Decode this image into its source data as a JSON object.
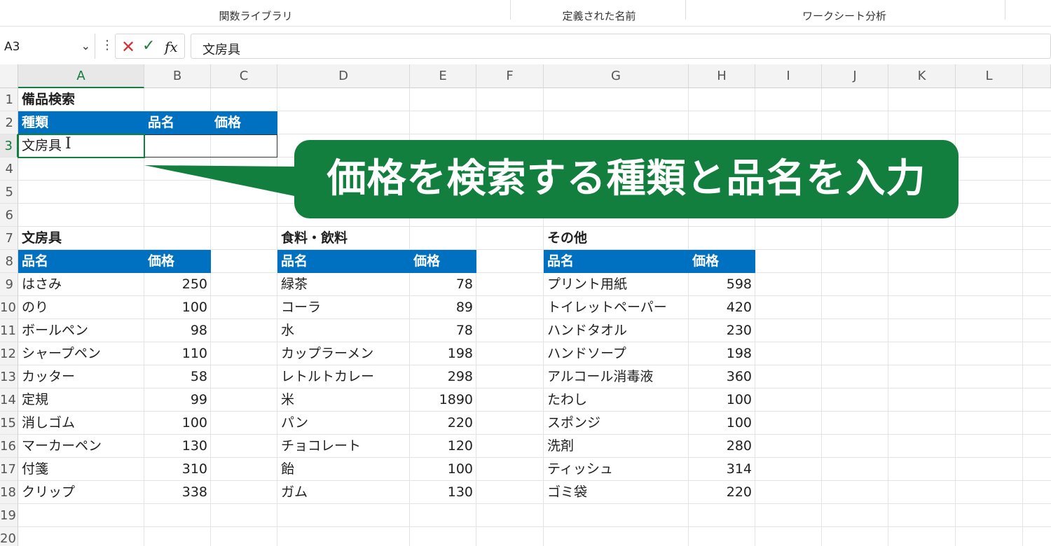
{
  "ribbon": {
    "groups": [
      "関数ライブラリ",
      "定義された名前",
      "ワークシート分析"
    ]
  },
  "formula_bar": {
    "name_box": "A3",
    "chevron_icon": "chevron-down-icon",
    "more_icon": "vertical-ellipsis-icon",
    "cancel_icon": "close-icon",
    "enter_icon": "check-icon",
    "fx_label": "fx",
    "content": "文房具"
  },
  "columns": [
    "A",
    "B",
    "C",
    "D",
    "E",
    "F",
    "G",
    "H",
    "I",
    "J",
    "K",
    "L"
  ],
  "rows": [
    "1",
    "2",
    "3",
    "4",
    "5",
    "6",
    "7",
    "8",
    "9",
    "10",
    "11",
    "12",
    "13",
    "14",
    "15",
    "16",
    "17",
    "18",
    "19",
    "20"
  ],
  "search": {
    "title": "備品検索",
    "headers": [
      "種類",
      "品名",
      "価格"
    ],
    "input_type": "文房具",
    "input_name": "",
    "input_price": ""
  },
  "tables": [
    {
      "title": "文房具",
      "headers": [
        "品名",
        "価格"
      ],
      "rows": [
        [
          "はさみ",
          "250"
        ],
        [
          "のり",
          "100"
        ],
        [
          "ボールペン",
          "98"
        ],
        [
          "シャープペン",
          "110"
        ],
        [
          "カッター",
          "58"
        ],
        [
          "定規",
          "99"
        ],
        [
          "消しゴム",
          "100"
        ],
        [
          "マーカーペン",
          "130"
        ],
        [
          "付箋",
          "310"
        ],
        [
          "クリップ",
          "338"
        ]
      ]
    },
    {
      "title": "食料・飲料",
      "headers": [
        "品名",
        "価格"
      ],
      "rows": [
        [
          "緑茶",
          "78"
        ],
        [
          "コーラ",
          "89"
        ],
        [
          "水",
          "78"
        ],
        [
          "カップラーメン",
          "198"
        ],
        [
          "レトルトカレー",
          "298"
        ],
        [
          "米",
          "1890"
        ],
        [
          "パン",
          "220"
        ],
        [
          "チョコレート",
          "120"
        ],
        [
          "飴",
          "100"
        ],
        [
          "ガム",
          "130"
        ]
      ]
    },
    {
      "title": "その他",
      "headers": [
        "品名",
        "価格"
      ],
      "rows": [
        [
          "プリント用紙",
          "598"
        ],
        [
          "トイレットペーパー",
          "420"
        ],
        [
          "ハンドタオル",
          "230"
        ],
        [
          "ハンドソープ",
          "198"
        ],
        [
          "アルコール消毒液",
          "360"
        ],
        [
          "たわし",
          "100"
        ],
        [
          "スポンジ",
          "100"
        ],
        [
          "洗剤",
          "280"
        ],
        [
          "ティッシュ",
          "314"
        ],
        [
          "ゴミ袋",
          "220"
        ]
      ]
    }
  ],
  "callout": {
    "text": "価格を検索する種類と品名を入力",
    "color": "#137f3f"
  },
  "colors": {
    "header_fill": "#0070c0",
    "selection": "#137f3f"
  }
}
